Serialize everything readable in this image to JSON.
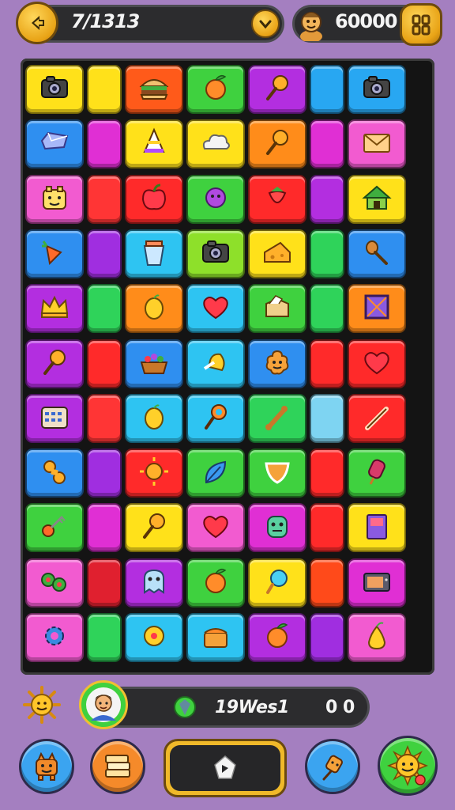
{
  "top_bar": {
    "level_text": "7/1313",
    "coins_text": "60000",
    "back_icon": "back-arrow-icon",
    "down_icon": "chevron-down-icon",
    "avatar_icon": "avatar-icon",
    "menu_icon": "grid-menu-icon"
  },
  "board": {
    "rows": [
      [
        {
          "color": "#ffe11a",
          "icon": "camera"
        },
        {
          "color": "#ffe11a",
          "icon": ""
        },
        {
          "color": "#ff5a1a",
          "icon": "burger"
        },
        {
          "color": "#3fd13f",
          "icon": "peach"
        },
        {
          "color": "#b32ee0",
          "icon": "lollipop"
        },
        {
          "color": "#28a7f2",
          "icon": ""
        },
        {
          "color": "#28a7f2",
          "icon": "camera"
        }
      ],
      [
        {
          "color": "#2f8ff0",
          "icon": "gem"
        },
        {
          "color": "#e02fd4",
          "icon": ""
        },
        {
          "color": "#ffe11a",
          "icon": "cone"
        },
        {
          "color": "#ffe11a",
          "icon": "cloud"
        },
        {
          "color": "#ff8c1a",
          "icon": "lollipop"
        },
        {
          "color": "#e02fd4",
          "icon": ""
        },
        {
          "color": "#f25bd0",
          "icon": "envelope"
        }
      ],
      [
        {
          "color": "#f25bd0",
          "icon": "face"
        },
        {
          "color": "#ff3535",
          "icon": ""
        },
        {
          "color": "#ff2a2a",
          "icon": "apple"
        },
        {
          "color": "#3fd13f",
          "icon": "blob"
        },
        {
          "color": "#ff2a2a",
          "icon": "strawberry"
        },
        {
          "color": "#b32ee0",
          "icon": ""
        },
        {
          "color": "#ffe11a",
          "icon": "house"
        }
      ],
      [
        {
          "color": "#2f8ff0",
          "icon": "carrot"
        },
        {
          "color": "#a02ee0",
          "icon": ""
        },
        {
          "color": "#2ec4f2",
          "icon": "cup"
        },
        {
          "color": "#8ee02a",
          "icon": "camera"
        },
        {
          "color": "#ffe11a",
          "icon": "cheese"
        },
        {
          "color": "#2fd35a",
          "icon": ""
        },
        {
          "color": "#2f8ff0",
          "icon": "spoon"
        }
      ],
      [
        {
          "color": "#b32ee0",
          "icon": "crown"
        },
        {
          "color": "#2fd35a",
          "icon": ""
        },
        {
          "color": "#ff8c1a",
          "icon": "lemon"
        },
        {
          "color": "#2ec4f2",
          "icon": "heart"
        },
        {
          "color": "#3fd13f",
          "icon": "box"
        },
        {
          "color": "#2fd35a",
          "icon": ""
        },
        {
          "color": "#ff8c1a",
          "icon": "frame"
        }
      ],
      [
        {
          "color": "#b32ee0",
          "icon": "lollipop"
        },
        {
          "color": "#ff2a2a",
          "icon": ""
        },
        {
          "color": "#2f8ff0",
          "icon": "basket"
        },
        {
          "color": "#2ec4f2",
          "icon": "bell"
        },
        {
          "color": "#2f8ff0",
          "icon": "cookie"
        },
        {
          "color": "#ff2a2a",
          "icon": ""
        },
        {
          "color": "#ff2a2a",
          "icon": "heart"
        }
      ],
      [
        {
          "color": "#b32ee0",
          "icon": "calculator"
        },
        {
          "color": "#ff3535",
          "icon": ""
        },
        {
          "color": "#2ec4f2",
          "icon": "lemon"
        },
        {
          "color": "#2ec4f2",
          "icon": "racket"
        },
        {
          "color": "#2fd35a",
          "icon": "bone"
        },
        {
          "color": "#7ed4f2",
          "icon": ""
        },
        {
          "color": "#ff2a2a",
          "icon": "stick"
        }
      ],
      [
        {
          "color": "#2f8ff0",
          "icon": "peanut"
        },
        {
          "color": "#a02ee0",
          "icon": ""
        },
        {
          "color": "#ff2a2a",
          "icon": "sun"
        },
        {
          "color": "#3fd13f",
          "icon": "leaf"
        },
        {
          "color": "#3fd13f",
          "icon": "shield"
        },
        {
          "color": "#ff2a2a",
          "icon": ""
        },
        {
          "color": "#3fd13f",
          "icon": "popsicle"
        }
      ],
      [
        {
          "color": "#3fd13f",
          "icon": "key"
        },
        {
          "color": "#e02fd4",
          "icon": ""
        },
        {
          "color": "#ffe11a",
          "icon": "lollipop"
        },
        {
          "color": "#f25bd0",
          "icon": "heart"
        },
        {
          "color": "#e02fd4",
          "icon": "monster"
        },
        {
          "color": "#ff2a2a",
          "icon": ""
        },
        {
          "color": "#ffe11a",
          "icon": "book"
        }
      ],
      [
        {
          "color": "#f25bd0",
          "icon": "olives"
        },
        {
          "color": "#e0202f",
          "icon": ""
        },
        {
          "color": "#b32ee0",
          "icon": "ghost"
        },
        {
          "color": "#3fd13f",
          "icon": "peach"
        },
        {
          "color": "#ffe11a",
          "icon": "icecream"
        },
        {
          "color": "#ff4a1a",
          "icon": ""
        },
        {
          "color": "#e02fd4",
          "icon": "tv"
        }
      ],
      [
        {
          "color": "#f25bd0",
          "icon": "gear"
        },
        {
          "color": "#2fd35a",
          "icon": ""
        },
        {
          "color": "#2ec4f2",
          "icon": "donut"
        },
        {
          "color": "#2ec4f2",
          "icon": "cake"
        },
        {
          "color": "#b32ee0",
          "icon": "peach"
        },
        {
          "color": "#a02ee0",
          "icon": ""
        },
        {
          "color": "#f25bd0",
          "icon": "pear"
        }
      ]
    ]
  },
  "bottom_bar": {
    "sun_icon": "sun-icon",
    "player_avatar_icon": "player-avatar-icon",
    "gem_icon": "green-gem-icon",
    "player_name": "19Wes1",
    "score": "0 0"
  },
  "actions": [
    {
      "name": "monster-button",
      "icon": "monster-icon",
      "color": "#3ba4f0"
    },
    {
      "name": "stack-button",
      "icon": "stack-icon",
      "color": "#f58a2a"
    },
    {
      "name": "play-button",
      "icon": "play-icon",
      "color": "#f0b92a"
    },
    {
      "name": "plug-button",
      "icon": "plug-icon",
      "color": "#3ba4f0"
    },
    {
      "name": "sun-face-button",
      "icon": "sun-face-icon",
      "color": "#3fd13f"
    }
  ]
}
